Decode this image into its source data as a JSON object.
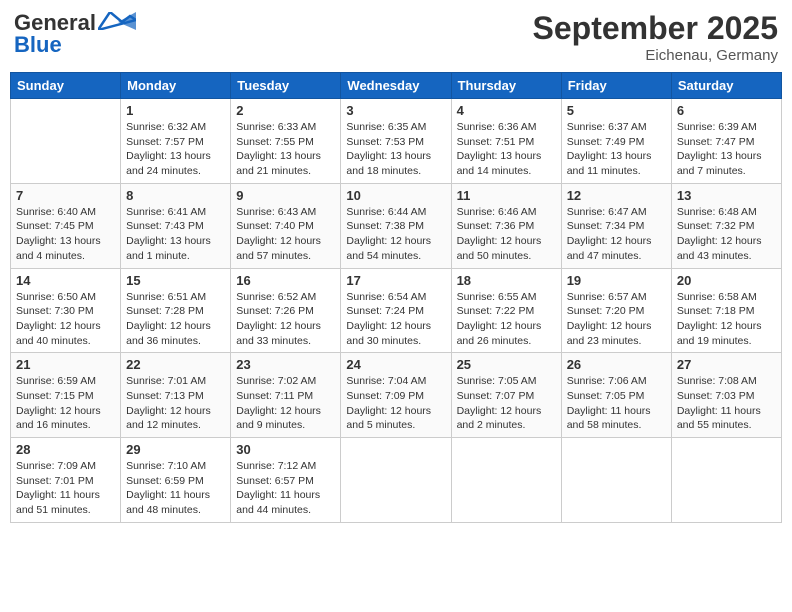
{
  "header": {
    "logo_line1": "General",
    "logo_line2": "Blue",
    "month": "September 2025",
    "location": "Eichenau, Germany"
  },
  "weekdays": [
    "Sunday",
    "Monday",
    "Tuesday",
    "Wednesday",
    "Thursday",
    "Friday",
    "Saturday"
  ],
  "weeks": [
    [
      {
        "day": "",
        "info": ""
      },
      {
        "day": "1",
        "info": "Sunrise: 6:32 AM\nSunset: 7:57 PM\nDaylight: 13 hours\nand 24 minutes."
      },
      {
        "day": "2",
        "info": "Sunrise: 6:33 AM\nSunset: 7:55 PM\nDaylight: 13 hours\nand 21 minutes."
      },
      {
        "day": "3",
        "info": "Sunrise: 6:35 AM\nSunset: 7:53 PM\nDaylight: 13 hours\nand 18 minutes."
      },
      {
        "day": "4",
        "info": "Sunrise: 6:36 AM\nSunset: 7:51 PM\nDaylight: 13 hours\nand 14 minutes."
      },
      {
        "day": "5",
        "info": "Sunrise: 6:37 AM\nSunset: 7:49 PM\nDaylight: 13 hours\nand 11 minutes."
      },
      {
        "day": "6",
        "info": "Sunrise: 6:39 AM\nSunset: 7:47 PM\nDaylight: 13 hours\nand 7 minutes."
      }
    ],
    [
      {
        "day": "7",
        "info": "Sunrise: 6:40 AM\nSunset: 7:45 PM\nDaylight: 13 hours\nand 4 minutes."
      },
      {
        "day": "8",
        "info": "Sunrise: 6:41 AM\nSunset: 7:43 PM\nDaylight: 13 hours\nand 1 minute."
      },
      {
        "day": "9",
        "info": "Sunrise: 6:43 AM\nSunset: 7:40 PM\nDaylight: 12 hours\nand 57 minutes."
      },
      {
        "day": "10",
        "info": "Sunrise: 6:44 AM\nSunset: 7:38 PM\nDaylight: 12 hours\nand 54 minutes."
      },
      {
        "day": "11",
        "info": "Sunrise: 6:46 AM\nSunset: 7:36 PM\nDaylight: 12 hours\nand 50 minutes."
      },
      {
        "day": "12",
        "info": "Sunrise: 6:47 AM\nSunset: 7:34 PM\nDaylight: 12 hours\nand 47 minutes."
      },
      {
        "day": "13",
        "info": "Sunrise: 6:48 AM\nSunset: 7:32 PM\nDaylight: 12 hours\nand 43 minutes."
      }
    ],
    [
      {
        "day": "14",
        "info": "Sunrise: 6:50 AM\nSunset: 7:30 PM\nDaylight: 12 hours\nand 40 minutes."
      },
      {
        "day": "15",
        "info": "Sunrise: 6:51 AM\nSunset: 7:28 PM\nDaylight: 12 hours\nand 36 minutes."
      },
      {
        "day": "16",
        "info": "Sunrise: 6:52 AM\nSunset: 7:26 PM\nDaylight: 12 hours\nand 33 minutes."
      },
      {
        "day": "17",
        "info": "Sunrise: 6:54 AM\nSunset: 7:24 PM\nDaylight: 12 hours\nand 30 minutes."
      },
      {
        "day": "18",
        "info": "Sunrise: 6:55 AM\nSunset: 7:22 PM\nDaylight: 12 hours\nand 26 minutes."
      },
      {
        "day": "19",
        "info": "Sunrise: 6:57 AM\nSunset: 7:20 PM\nDaylight: 12 hours\nand 23 minutes."
      },
      {
        "day": "20",
        "info": "Sunrise: 6:58 AM\nSunset: 7:18 PM\nDaylight: 12 hours\nand 19 minutes."
      }
    ],
    [
      {
        "day": "21",
        "info": "Sunrise: 6:59 AM\nSunset: 7:15 PM\nDaylight: 12 hours\nand 16 minutes."
      },
      {
        "day": "22",
        "info": "Sunrise: 7:01 AM\nSunset: 7:13 PM\nDaylight: 12 hours\nand 12 minutes."
      },
      {
        "day": "23",
        "info": "Sunrise: 7:02 AM\nSunset: 7:11 PM\nDaylight: 12 hours\nand 9 minutes."
      },
      {
        "day": "24",
        "info": "Sunrise: 7:04 AM\nSunset: 7:09 PM\nDaylight: 12 hours\nand 5 minutes."
      },
      {
        "day": "25",
        "info": "Sunrise: 7:05 AM\nSunset: 7:07 PM\nDaylight: 12 hours\nand 2 minutes."
      },
      {
        "day": "26",
        "info": "Sunrise: 7:06 AM\nSunset: 7:05 PM\nDaylight: 11 hours\nand 58 minutes."
      },
      {
        "day": "27",
        "info": "Sunrise: 7:08 AM\nSunset: 7:03 PM\nDaylight: 11 hours\nand 55 minutes."
      }
    ],
    [
      {
        "day": "28",
        "info": "Sunrise: 7:09 AM\nSunset: 7:01 PM\nDaylight: 11 hours\nand 51 minutes."
      },
      {
        "day": "29",
        "info": "Sunrise: 7:10 AM\nSunset: 6:59 PM\nDaylight: 11 hours\nand 48 minutes."
      },
      {
        "day": "30",
        "info": "Sunrise: 7:12 AM\nSunset: 6:57 PM\nDaylight: 11 hours\nand 44 minutes."
      },
      {
        "day": "",
        "info": ""
      },
      {
        "day": "",
        "info": ""
      },
      {
        "day": "",
        "info": ""
      },
      {
        "day": "",
        "info": ""
      }
    ]
  ]
}
